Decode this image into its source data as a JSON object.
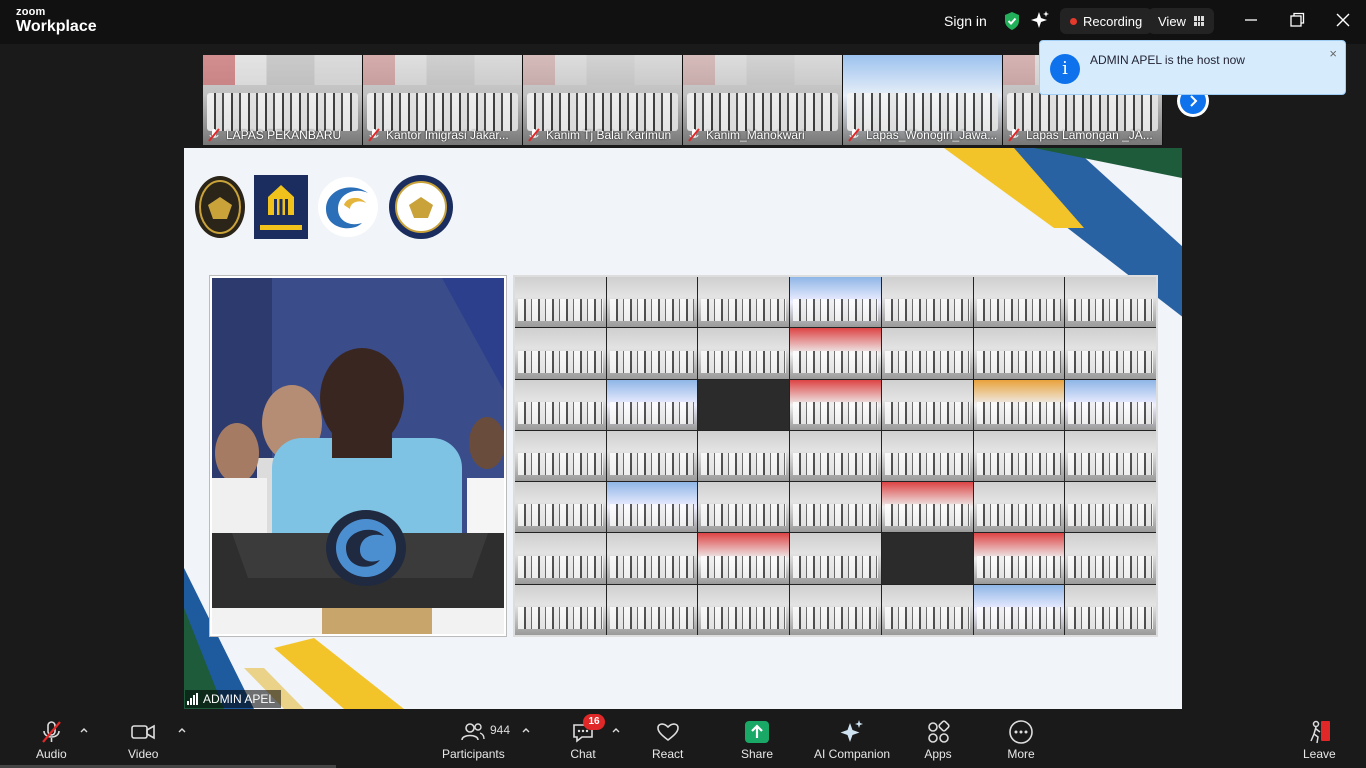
{
  "titlebar": {
    "brand_small": "zoom",
    "brand_large": "Workplace",
    "sign_in": "Sign in",
    "recording": "Recording",
    "view": "View"
  },
  "strip": {
    "tiles": [
      {
        "label": "LAPAS PEKANBARU"
      },
      {
        "label": "Kantor Imigrasi Jakar..."
      },
      {
        "label": "Kanim Tj Balai Karimun"
      },
      {
        "label": "Kanim_Manokwari"
      },
      {
        "label": "Lapas_Wonogiri_Jawa..."
      },
      {
        "label": "Lapas Lamongan _JA..."
      }
    ]
  },
  "toast": {
    "message": "ADMIN APEL is the host now",
    "close": "×",
    "info_glyph": "i"
  },
  "share": {
    "presenter_name": "ADMIN APEL"
  },
  "toolbar": {
    "audio": "Audio",
    "video": "Video",
    "participants": "Participants",
    "participants_count": "944",
    "chat": "Chat",
    "chat_badge": "16",
    "react": "React",
    "share": "Share",
    "ai_companion": "AI Companion",
    "apps": "Apps",
    "more": "More",
    "leave": "Leave"
  },
  "colors": {
    "accent_blue": "#0e72ed",
    "share_green": "#1aa867",
    "record_red": "#e5392b",
    "badge_red": "#e02828",
    "toast_bg": "#d6ecfd"
  }
}
